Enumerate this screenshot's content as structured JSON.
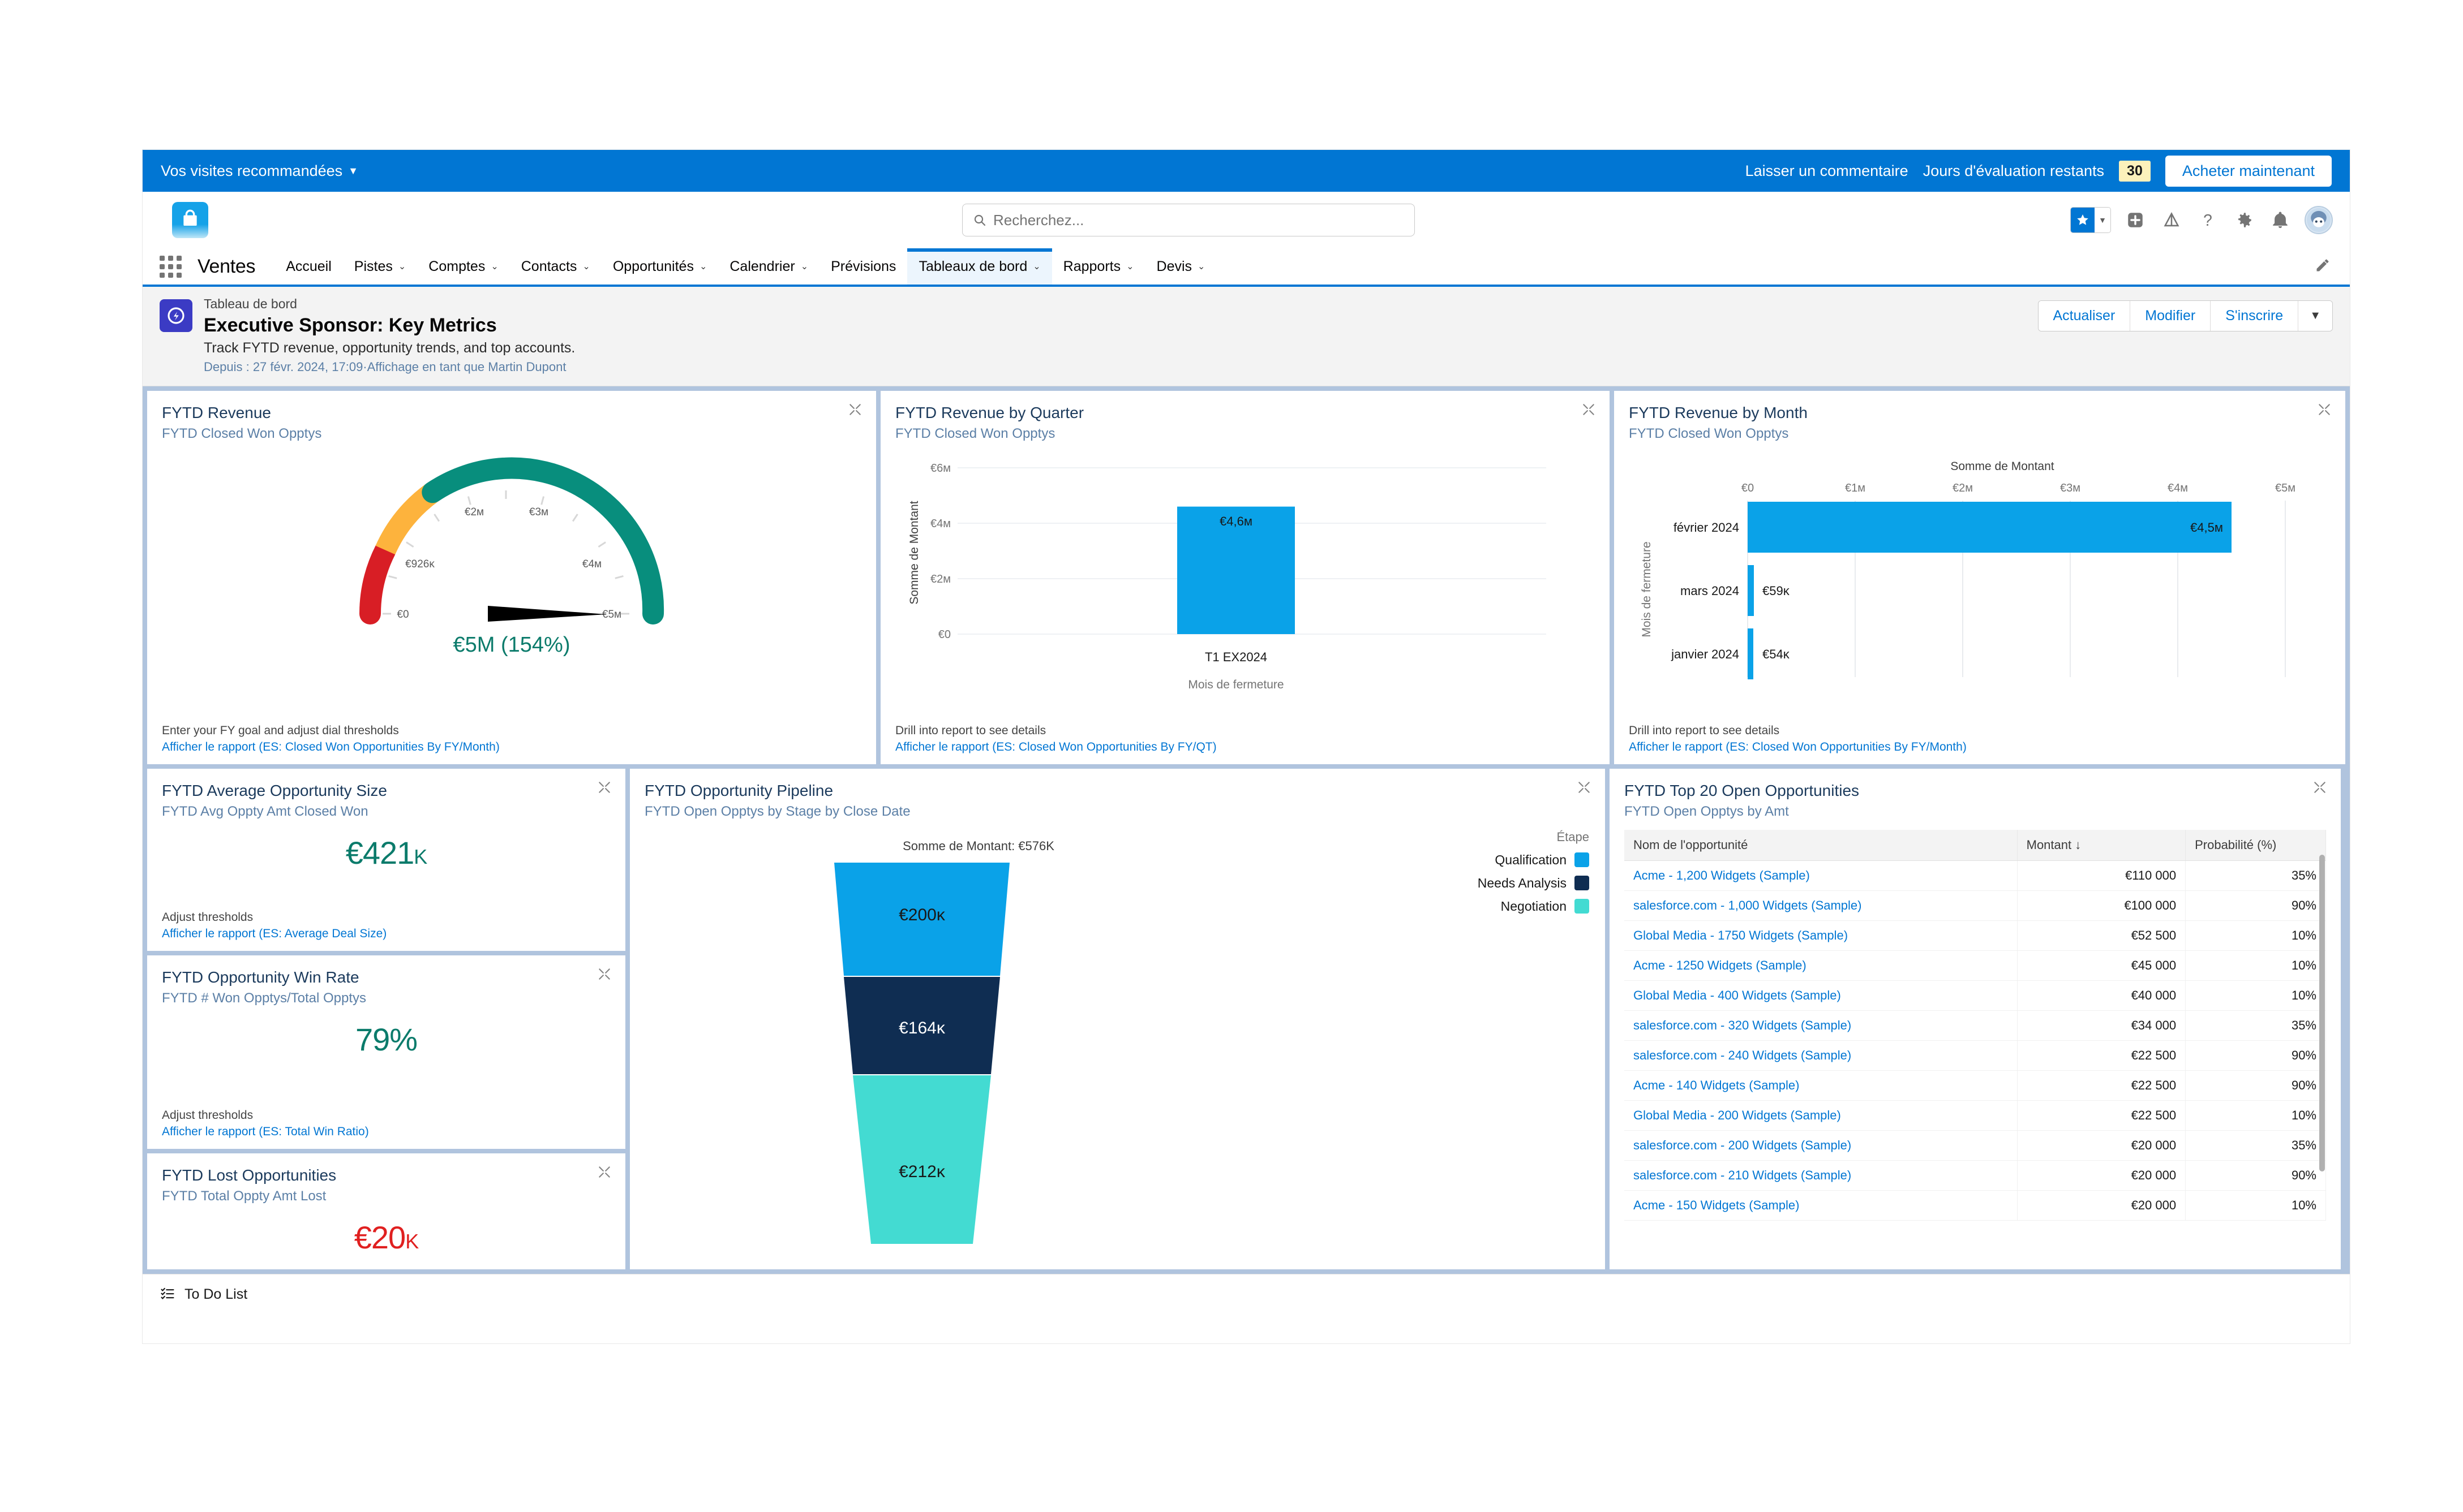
{
  "trial_bar": {
    "recommended_label": "Vos visites recommandées",
    "comment_link": "Laisser un commentaire",
    "trial_label": "Jours d'évaluation restants",
    "trial_days": "30",
    "buy_button": "Acheter maintenant"
  },
  "header": {
    "search_placeholder": "Recherchez...",
    "search_value": ""
  },
  "nav": {
    "app_name": "Ventes",
    "items": [
      {
        "label": "Accueil",
        "has_menu": false,
        "active": false
      },
      {
        "label": "Pistes",
        "has_menu": true,
        "active": false
      },
      {
        "label": "Comptes",
        "has_menu": true,
        "active": false
      },
      {
        "label": "Contacts",
        "has_menu": true,
        "active": false
      },
      {
        "label": "Opportunités",
        "has_menu": true,
        "active": false
      },
      {
        "label": "Calendrier",
        "has_menu": true,
        "active": false
      },
      {
        "label": "Prévisions",
        "has_menu": false,
        "active": false
      },
      {
        "label": "Tableaux de bord",
        "has_menu": true,
        "active": true
      },
      {
        "label": "Rapports",
        "has_menu": true,
        "active": false
      },
      {
        "label": "Devis",
        "has_menu": true,
        "active": false
      }
    ]
  },
  "dashboard_header": {
    "kicker": "Tableau de bord",
    "title": "Executive Sponsor: Key Metrics",
    "description": "Track FYTD revenue, opportunity trends, and top accounts.",
    "meta": "Depuis : 27 févr. 2024, 17:09·Affichage en tant que Martin Dupont",
    "actions": {
      "refresh": "Actualiser",
      "edit": "Modifier",
      "subscribe": "S'inscrire",
      "more": "▼"
    }
  },
  "panels": {
    "revenue_gauge": {
      "title": "FYTD Revenue",
      "subtitle": "FYTD Closed Won Opptys",
      "footnote": "Enter your FY goal and adjust dial thresholds",
      "report_link": "Afficher le rapport (ES: Closed Won Opportunities By FY/Month)"
    },
    "revenue_quarter": {
      "title": "FYTD Revenue by Quarter",
      "subtitle": "FYTD Closed Won Opptys",
      "footnote": "Drill into report to see details",
      "report_link": "Afficher le rapport (ES: Closed Won Opportunities By FY/QT)"
    },
    "revenue_month": {
      "title": "FYTD Revenue by Month",
      "subtitle": "FYTD Closed Won Opptys",
      "footnote": "Drill into report to see details",
      "report_link": "Afficher le rapport (ES: Closed Won Opportunities By FY/Month)"
    },
    "avg_opp_size": {
      "title": "FYTD Average Opportunity Size",
      "subtitle": "FYTD Avg Oppty Amt Closed Won",
      "value": "€421",
      "value_unit": "K",
      "footnote": "Adjust thresholds",
      "report_link": "Afficher le rapport (ES: Average Deal Size)"
    },
    "win_rate": {
      "title": "FYTD Opportunity Win Rate",
      "subtitle": "FYTD # Won Opptys/Total Opptys",
      "value": "79%",
      "footnote": "Adjust thresholds",
      "report_link": "Afficher le rapport (ES: Total Win Ratio)"
    },
    "lost_opps": {
      "title": "FYTD Lost Opportunities",
      "subtitle": "FYTD Total Oppty Amt Lost",
      "value": "€20",
      "value_unit": "K"
    },
    "pipeline": {
      "title": "FYTD Opportunity Pipeline",
      "subtitle": "FYTD Open Opptys by Stage by Close Date",
      "legend_title": "Étape"
    },
    "top_opps": {
      "title": "FYTD Top 20 Open Opportunities",
      "subtitle": "FYTD Open Opptys by Amt"
    }
  },
  "chart_data": [
    {
      "id": "revenue_gauge",
      "type": "gauge",
      "title": "FYTD Revenue",
      "value": 5000000,
      "value_label": "€5M (154%)",
      "min": 0,
      "max": 5000000,
      "tick_labels": [
        "€0",
        "€926K",
        "€2M",
        "€3M",
        "€4M",
        "€5M"
      ],
      "tick_values": [
        0,
        926000,
        2000000,
        3000000,
        4000000,
        5000000
      ],
      "segments": [
        {
          "name": "low",
          "from": 0,
          "to": 926000,
          "color": "#d81e25"
        },
        {
          "name": "medium",
          "from": 926000,
          "to": 1850000,
          "color": "#fdb33d"
        },
        {
          "name": "high",
          "from": 1850000,
          "to": 5000000,
          "color": "#088e7d"
        }
      ],
      "needle_value": 5000000
    },
    {
      "id": "revenue_quarter",
      "type": "bar",
      "title": "FYTD Revenue by Quarter",
      "categories": [
        "T1 EX2024"
      ],
      "values": [
        4600000
      ],
      "data_labels": [
        "€4,6M"
      ],
      "ylabel": "Somme de Montant",
      "xlabel": "Mois de fermeture",
      "ytick_labels": [
        "€0",
        "€2M",
        "€4M",
        "€6M"
      ],
      "ytick_values": [
        0,
        2000000,
        4000000,
        6000000
      ],
      "ylim": [
        0,
        6000000
      ],
      "bar_color": "#0aa2e8",
      "grid": true
    },
    {
      "id": "revenue_month",
      "type": "bar",
      "orientation": "horizontal",
      "title": "FYTD Revenue by Month",
      "axis_title": "Somme de Montant",
      "ylabel": "Mois de fermeture",
      "categories": [
        "février 2024",
        "mars 2024",
        "janvier 2024"
      ],
      "values": [
        4500000,
        59000,
        54000
      ],
      "data_labels": [
        "€4,5M",
        "€59K",
        "€54K"
      ],
      "xtick_labels": [
        "€0",
        "€1M",
        "€2M",
        "€3M",
        "€4M",
        "€5M"
      ],
      "xtick_values": [
        0,
        1000000,
        2000000,
        3000000,
        4000000,
        5000000
      ],
      "xlim": [
        0,
        5000000
      ],
      "bar_color": "#0aa2e8",
      "grid": true
    },
    {
      "id": "pipeline",
      "type": "funnel",
      "title": "FYTD Opportunity Pipeline",
      "total_label": "Somme de Montant: €576K",
      "total_value": 576000,
      "legend_title": "Étape",
      "segments": [
        {
          "label": "Qualification",
          "value": 200000,
          "data_label": "€200K",
          "color": "#0aa2e8"
        },
        {
          "label": "Needs Analysis",
          "value": 164000,
          "data_label": "€164K",
          "color": "#0f2d52"
        },
        {
          "label": "Negotiation",
          "value": 212000,
          "data_label": "€212K",
          "color": "#43dbd2"
        }
      ]
    },
    {
      "id": "top_opps",
      "type": "table",
      "title": "FYTD Top 20 Open Opportunities",
      "columns": [
        "Nom de l'opportunité",
        "Montant ↓",
        "Probabilité (%)"
      ],
      "rows": [
        [
          "Acme - 1,200 Widgets (Sample)",
          "€110 000",
          "35%"
        ],
        [
          "salesforce.com - 1,000 Widgets (Sample)",
          "€100 000",
          "90%"
        ],
        [
          "Global Media - 1750 Widgets (Sample)",
          "€52 500",
          "10%"
        ],
        [
          "Acme - 1250 Widgets (Sample)",
          "€45 000",
          "10%"
        ],
        [
          "Global Media - 400 Widgets (Sample)",
          "€40 000",
          "10%"
        ],
        [
          "salesforce.com - 320 Widgets (Sample)",
          "€34 000",
          "35%"
        ],
        [
          "salesforce.com - 240 Widgets (Sample)",
          "€22 500",
          "90%"
        ],
        [
          "Acme - 140 Widgets (Sample)",
          "€22 500",
          "90%"
        ],
        [
          "Global Media - 200 Widgets (Sample)",
          "€22 500",
          "10%"
        ],
        [
          "salesforce.com - 200 Widgets (Sample)",
          "€20 000",
          "35%"
        ],
        [
          "salesforce.com - 210 Widgets (Sample)",
          "€20 000",
          "90%"
        ],
        [
          "Acme - 150 Widgets (Sample)",
          "€20 000",
          "10%"
        ]
      ]
    }
  ],
  "footer": {
    "todo_label": "To Do List"
  },
  "colors": {
    "brand_blue": "#0176d3",
    "chart_blue": "#0aa2e8",
    "green": "#0b7b6b",
    "red": "#e02020",
    "gauge_red": "#d81e25",
    "gauge_orange": "#fdb33d",
    "gauge_green": "#088e7d"
  }
}
